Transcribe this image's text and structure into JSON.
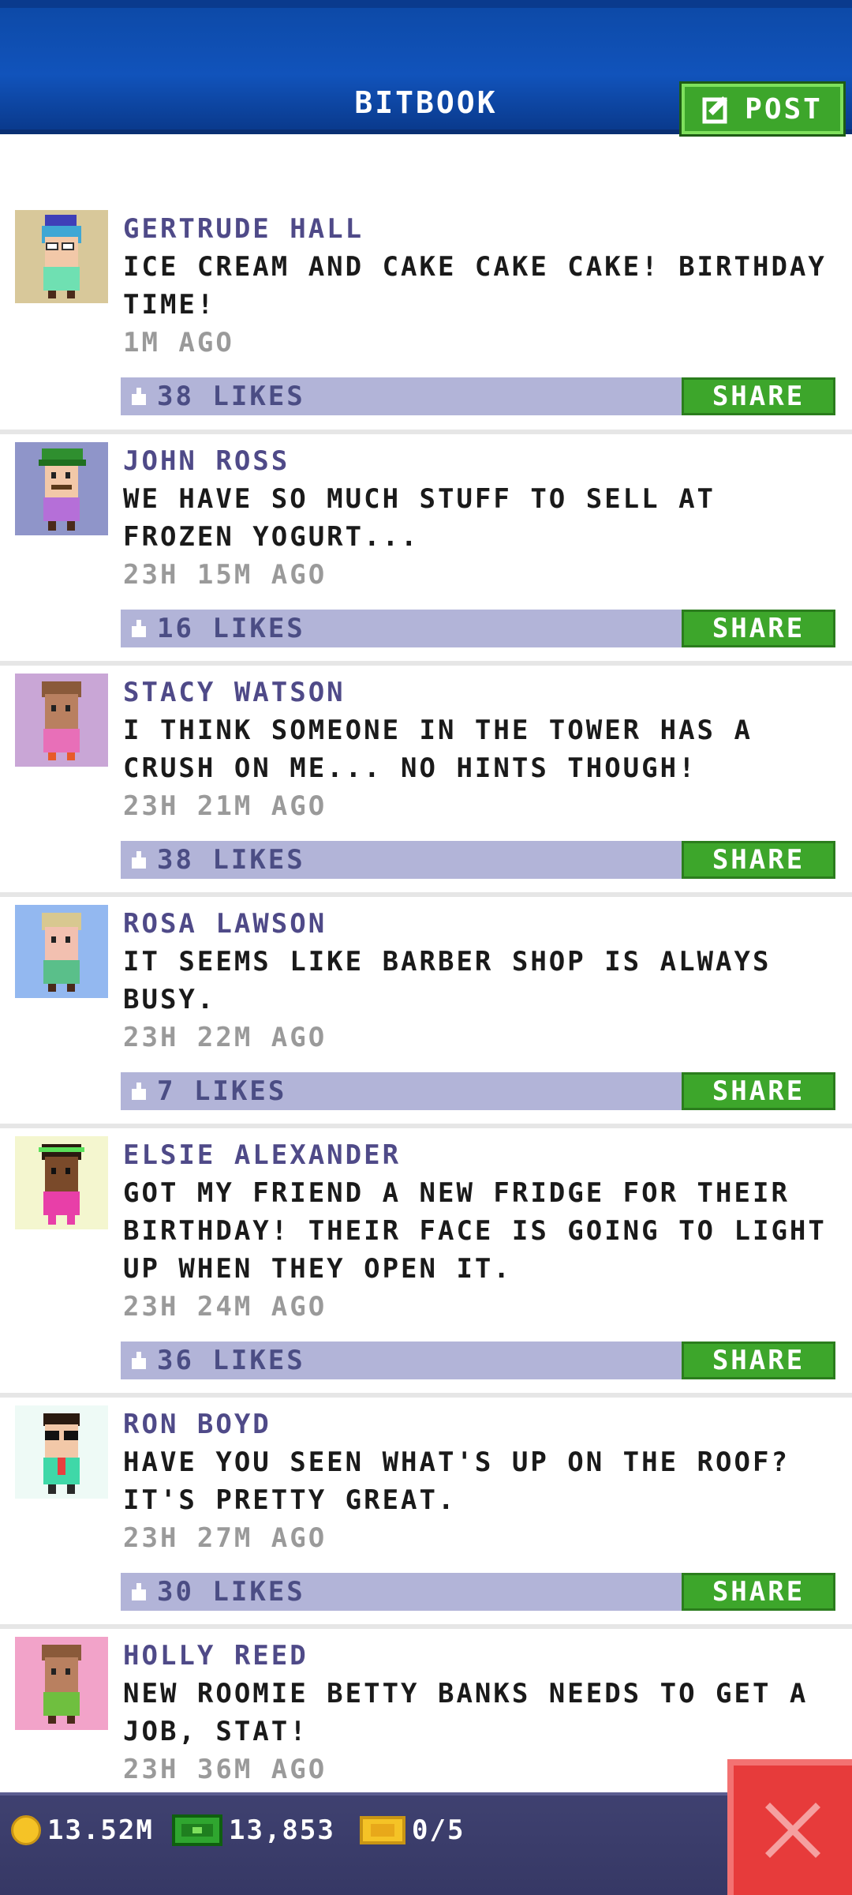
{
  "header": {
    "title": "BITBOOK",
    "post_label": "POST"
  },
  "posts": [
    {
      "author": "GERTRUDE HALL",
      "message": "ICE CREAM AND CAKE CAKE CAKE! BIRTHDAY TIME!",
      "time": "1M AGO",
      "likes": "38 LIKES",
      "share": "SHARE",
      "avatar_bg": "#d8c89a"
    },
    {
      "author": "JOHN ROSS",
      "message": "WE HAVE SO MUCH STUFF TO SELL AT FROZEN YOGURT...",
      "time": "23H 15M AGO",
      "likes": "16 LIKES",
      "share": "SHARE",
      "avatar_bg": "#8f95c9"
    },
    {
      "author": "STACY WATSON",
      "message": "I THINK SOMEONE IN THE TOWER HAS A CRUSH ON ME... NO HINTS THOUGH!",
      "time": "23H 21M AGO",
      "likes": "38 LIKES",
      "share": "SHARE",
      "avatar_bg": "#c9a6d6"
    },
    {
      "author": "ROSA LAWSON",
      "message": "IT SEEMS LIKE BARBER SHOP IS ALWAYS BUSY.",
      "time": "23H 22M AGO",
      "likes": "7 LIKES",
      "share": "SHARE",
      "avatar_bg": "#93b8f0"
    },
    {
      "author": "ELSIE ALEXANDER",
      "message": "GOT MY FRIEND A NEW FRIDGE FOR THEIR BIRTHDAY! THEIR FACE IS GOING TO LIGHT UP WHEN THEY OPEN IT.",
      "time": "23H 24M AGO",
      "likes": "36 LIKES",
      "share": "SHARE",
      "avatar_bg": "#f4f6cf"
    },
    {
      "author": "RON BOYD",
      "message": "HAVE YOU SEEN WHAT'S UP ON THE ROOF? IT'S PRETTY GREAT.",
      "time": "23H 27M AGO",
      "likes": "30 LIKES",
      "share": "SHARE",
      "avatar_bg": "#eefaf6"
    },
    {
      "author": "HOLLY REED",
      "message": "NEW ROOMIE BETTY BANKS NEEDS TO GET A JOB, STAT!",
      "time": "23H 36M AGO",
      "likes": "",
      "share": "",
      "avatar_bg": "#f2a3c9"
    }
  ],
  "footer": {
    "coins": "13.52M",
    "bux": "13,853",
    "tickets": "0/5"
  },
  "colors": {
    "header_blue": "#1153bb",
    "share_green": "#3da62b",
    "like_bar": "#b2b4d8",
    "author_purple": "#4f4a88",
    "close_red": "#e73b3b"
  }
}
